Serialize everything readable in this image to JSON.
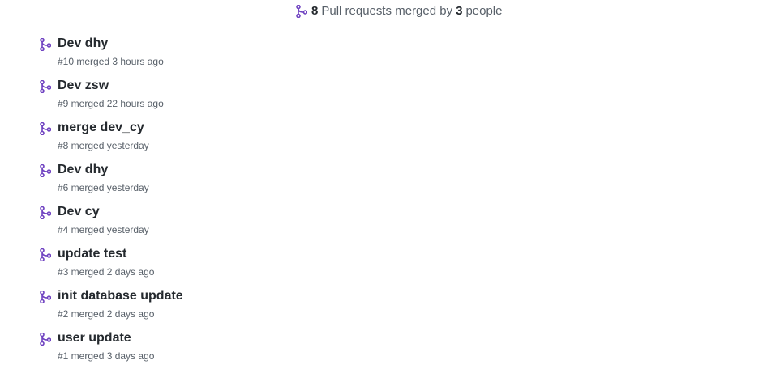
{
  "summary": {
    "pr_count": "8",
    "text_middle": "Pull requests merged by",
    "people_count": "3",
    "text_end": "people",
    "icon": "git-merge-icon"
  },
  "colors": {
    "merge_icon": "#6f42c1",
    "title": "#24292e",
    "meta": "#586069",
    "divider": "#e1e4e8"
  },
  "pull_requests": [
    {
      "title": "Dev dhy",
      "meta": "#10 merged 3 hours ago",
      "icon": "git-merge-icon"
    },
    {
      "title": "Dev zsw",
      "meta": "#9 merged 22 hours ago",
      "icon": "git-merge-icon"
    },
    {
      "title": "merge dev_cy",
      "meta": "#8 merged yesterday",
      "icon": "git-merge-icon"
    },
    {
      "title": "Dev dhy",
      "meta": "#6 merged yesterday",
      "icon": "git-merge-icon"
    },
    {
      "title": "Dev cy",
      "meta": "#4 merged yesterday",
      "icon": "git-merge-icon"
    },
    {
      "title": "update test",
      "meta": "#3 merged 2 days ago",
      "icon": "git-merge-icon"
    },
    {
      "title": "init database update",
      "meta": "#2 merged 2 days ago",
      "icon": "git-merge-icon"
    },
    {
      "title": "user update",
      "meta": "#1 merged 3 days ago",
      "icon": "git-merge-icon"
    }
  ]
}
